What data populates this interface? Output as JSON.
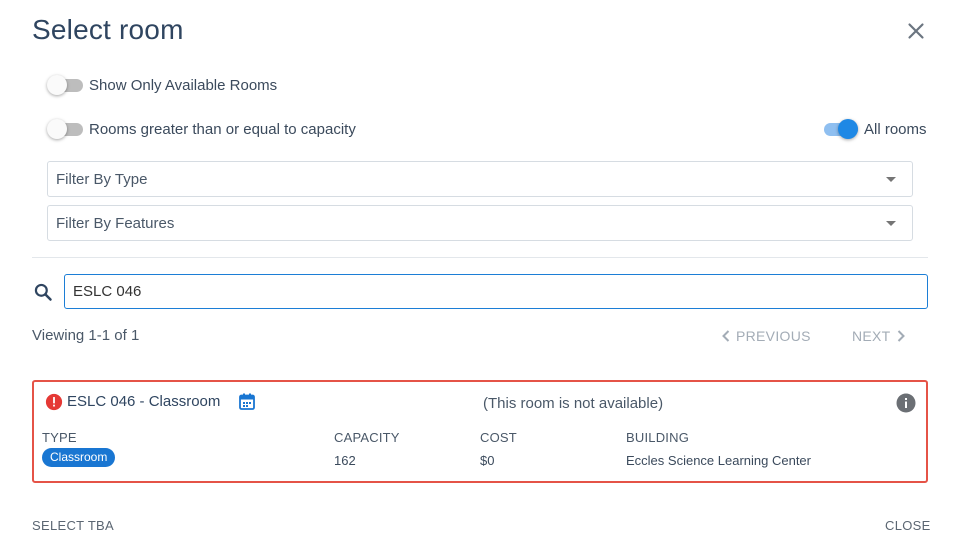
{
  "dialog": {
    "title": "Select room"
  },
  "toggles": {
    "available_label": "Show Only Available Rooms",
    "available_on": false,
    "capacity_label": "Rooms greater than or equal to capacity",
    "capacity_on": false,
    "all_rooms_label": "All rooms",
    "all_rooms_on": true
  },
  "filters": {
    "type_placeholder": "Filter By Type",
    "features_placeholder": "Filter By Features"
  },
  "search": {
    "value": "ESLC 046"
  },
  "pagination": {
    "viewing": "Viewing 1-1 of 1",
    "previous_label": "PREVIOUS",
    "next_label": "NEXT"
  },
  "room": {
    "title": "ESLC 046 - Classroom",
    "availability": "(This room is not available)",
    "headers": {
      "type": "TYPE",
      "capacity": "CAPACITY",
      "cost": "COST",
      "building": "BUILDING"
    },
    "type": "Classroom",
    "capacity": "162",
    "cost": "$0",
    "building": "Eccles Science Learning Center"
  },
  "footer": {
    "select_tba_label": "SELECT TBA",
    "close_label": "CLOSE"
  },
  "colors": {
    "accent": "#1e88e5",
    "error": "#e53935",
    "title": "#2f4560"
  },
  "icons": {
    "close": "close-icon",
    "search": "search-icon",
    "alert": "alert-circle-icon",
    "calendar": "calendar-icon",
    "info": "info-icon"
  }
}
